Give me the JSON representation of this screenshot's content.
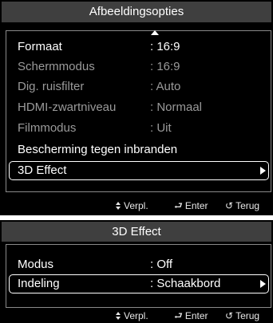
{
  "picture_menu": {
    "title": "Afbeeldingsopties",
    "items": [
      {
        "label": "Formaat",
        "value": ": 16:9"
      },
      {
        "label": "Schermmodus",
        "value": ": 16:9"
      },
      {
        "label": "Dig. ruisfilter",
        "value": ": Auto"
      },
      {
        "label": "HDMI-zwartniveau",
        "value": ": Normaal"
      },
      {
        "label": "Filmmodus",
        "value": ": Uit"
      },
      {
        "label": "Bescherming tegen inbranden"
      },
      {
        "label": "3D Effect"
      }
    ],
    "footer": {
      "move": "Verpl.",
      "enter": "Enter",
      "back": "Terug"
    }
  },
  "effect_menu": {
    "title": "3D Effect",
    "items": [
      {
        "label": "Modus",
        "value": ": Off"
      },
      {
        "label": "Indeling",
        "value": ": Schaakbord"
      }
    ],
    "footer": {
      "move": "Verpl.",
      "enter": "Enter",
      "back": "Terug"
    }
  },
  "icons": {
    "move": "up-down-arrows-icon",
    "enter": "enter-icon",
    "back": "return-icon",
    "submenu": "triangle-right-icon",
    "scroll_up": "triangle-up-icon"
  },
  "colors": {
    "background": "#000000",
    "title_bar": "#3f3f3f",
    "dimmed_text": "#9a9a9a",
    "text": "#ffffff"
  }
}
